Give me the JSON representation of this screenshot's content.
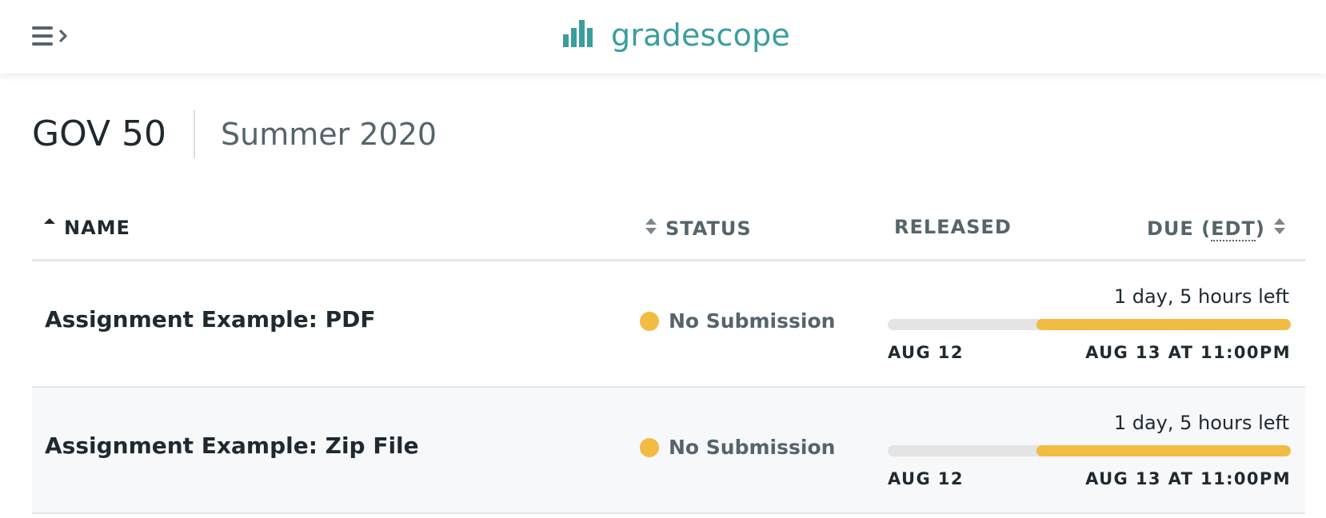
{
  "app": {
    "brand_name": "gradescope",
    "brand_color": "#3a9e9e",
    "menu_icon": "hamburger-menu-icon",
    "logo_icon": "bar-chart-logo-icon"
  },
  "course": {
    "name": "GOV 50",
    "term": "Summer 2020"
  },
  "table": {
    "columns": {
      "name": "NAME",
      "status": "STATUS",
      "released": "RELEASED",
      "due_prefix": "DUE (",
      "due_tz": "EDT",
      "due_suffix": ")"
    },
    "sort": {
      "name": "ascending",
      "status": "unsorted",
      "due": "unsorted"
    },
    "rows": [
      {
        "name": "Assignment Example: PDF",
        "status": "No Submission",
        "status_color": "#f2bb42",
        "time_left": "1 day, 5 hours left",
        "released": "AUG 12",
        "due": "AUG 13 AT 11:00PM",
        "remaining_fraction": 0.63
      },
      {
        "name": "Assignment Example: Zip File",
        "status": "No Submission",
        "status_color": "#f2bb42",
        "time_left": "1 day, 5 hours left",
        "released": "AUG 12",
        "due": "AUG 13 AT 11:00PM",
        "remaining_fraction": 0.63
      }
    ]
  }
}
